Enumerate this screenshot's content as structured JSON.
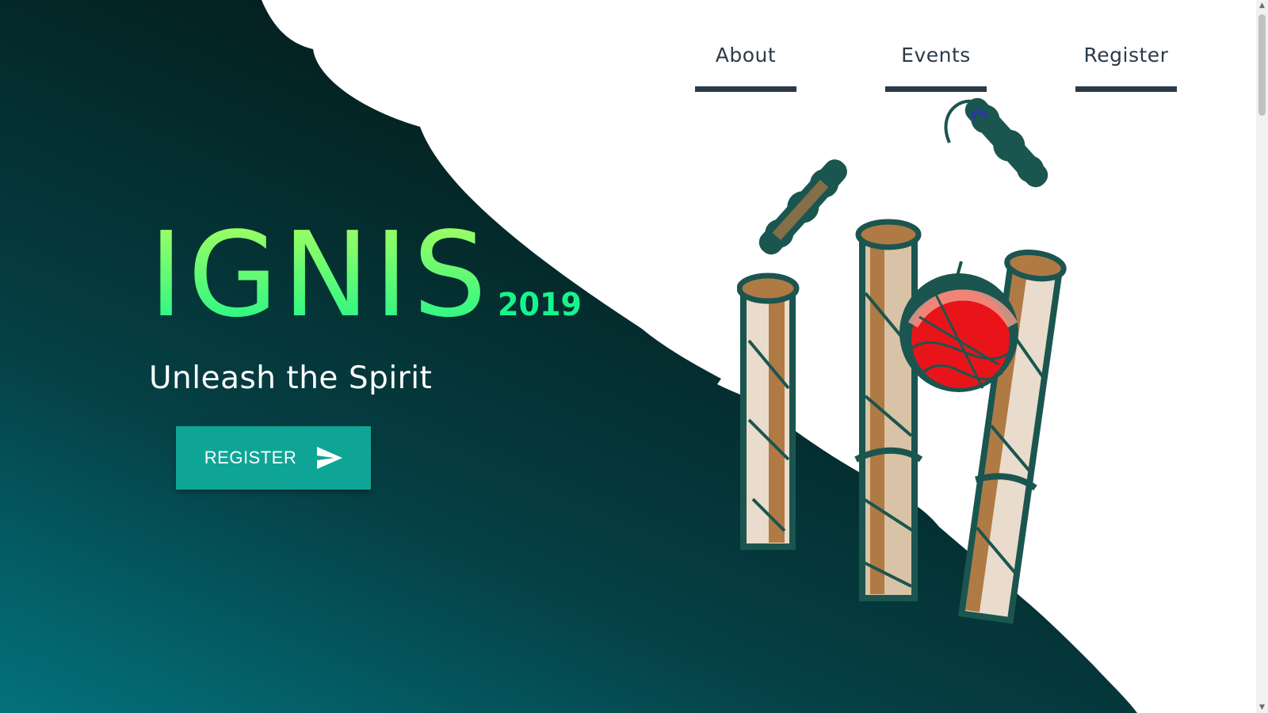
{
  "nav": {
    "items": [
      {
        "label": "About"
      },
      {
        "label": "Events"
      },
      {
        "label": "Register"
      }
    ],
    "color": "#2b3a48"
  },
  "hero": {
    "title": "IGNIS",
    "year": "2019",
    "tagline": "Unleash the Spirit",
    "cta_label": "REGISTER",
    "cta_icon": "send-icon",
    "colors": {
      "gradient_dark": "#04201f",
      "gradient_light": "#03727c",
      "title_top": "#b2ff5c",
      "title_bottom": "#14f58d",
      "button": "#0fa596"
    }
  },
  "illustration": {
    "subject": "cricket-stumps-ball-icon"
  },
  "scrollbar": {
    "up_icon": "▲",
    "down_icon": "▼"
  }
}
